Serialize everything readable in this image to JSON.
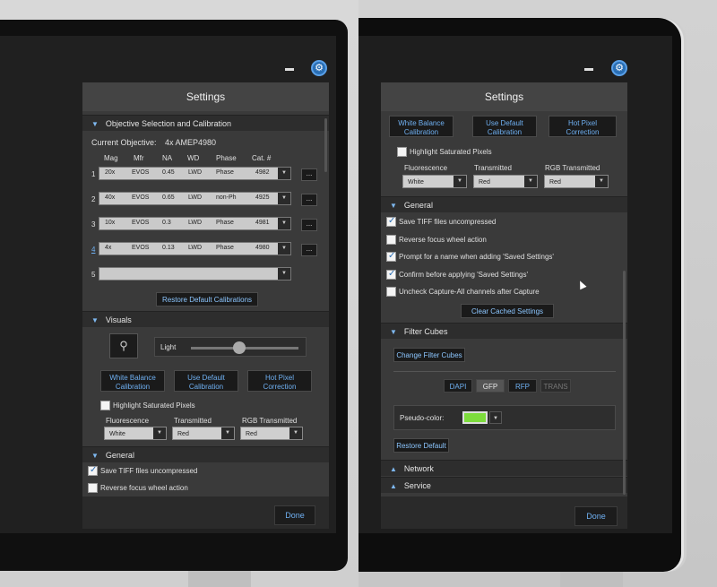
{
  "settings_title": "Settings",
  "done_label": "Done",
  "window_controls": {
    "minimize_glyph": "▬",
    "settings_glyph": "⚙"
  },
  "objective": {
    "section_label": "Objective Selection and Calibration",
    "current_label": "Current Objective:",
    "current_value": "4x AMEP4980",
    "columns": [
      "Mag",
      "Mfr",
      "NA",
      "WD",
      "Phase",
      "Cat. #"
    ],
    "rows": [
      {
        "index": "1",
        "mag": "20x",
        "mfr": "EVOS",
        "na": "0.45",
        "wd": "LWD",
        "phase": "Phase",
        "cat": "4982"
      },
      {
        "index": "2",
        "mag": "40x",
        "mfr": "EVOS",
        "na": "0.65",
        "wd": "LWD",
        "phase": "non-Ph",
        "cat": "4925"
      },
      {
        "index": "3",
        "mag": "10x",
        "mfr": "EVOS",
        "na": "0.3",
        "wd": "LWD",
        "phase": "Phase",
        "cat": "4981"
      },
      {
        "index": "4",
        "mag": "4x",
        "mfr": "EVOS",
        "na": "0.13",
        "wd": "LWD",
        "phase": "Phase",
        "cat": "4980"
      },
      {
        "index": "5",
        "mag": "",
        "mfr": "",
        "na": "",
        "wd": "",
        "phase": "",
        "cat": ""
      }
    ],
    "more_label": "...",
    "restore_label": "Restore Default Calibrations"
  },
  "visuals": {
    "section_label": "Visuals",
    "light_label": "Light",
    "light_level": 0.45,
    "white_balance": "White Balance\nCalibration",
    "use_default": "Use Default\nCalibration",
    "hot_pixel": "Hot Pixel\nCorrection",
    "highlight_label": "Highlight Saturated Pixels",
    "fluorescence_label": "Fluorescence",
    "transmitted_label": "Transmitted",
    "rgb_label": "RGB Transmitted",
    "fluorescence_value": "White",
    "transmitted_value": "Red",
    "rgb_value": "Red"
  },
  "general": {
    "section_label": "General",
    "options": [
      {
        "label": "Save TIFF files uncompressed",
        "checked": true
      },
      {
        "label": "Reverse focus wheel action",
        "checked": false
      },
      {
        "label": "Prompt for a name when adding 'Saved Settings'",
        "checked": true
      },
      {
        "label": "Confirm before applying 'Saved Settings'",
        "checked": true
      },
      {
        "label": "Uncheck Capture-All channels after Capture",
        "checked": false
      }
    ],
    "clear_cache_label": "Clear Cached Settings"
  },
  "filter_cubes": {
    "section_label": "Filter Cubes",
    "change_label": "Change Filter Cubes",
    "cubes": [
      "DAPI",
      "GFP",
      "RFP",
      "TRANS"
    ],
    "pseudo_label": "Pseudo-color:",
    "pseudo_color": "#7ddc3c",
    "restore_label": "Restore Default"
  },
  "network_label": "Network",
  "service_label": "Service"
}
